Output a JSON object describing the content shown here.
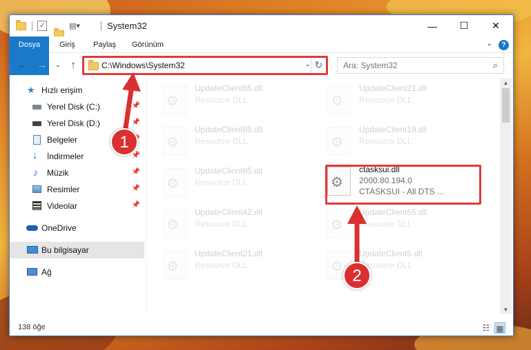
{
  "window": {
    "title": "System32",
    "controls": {
      "minimize": "—",
      "maximize": "☐",
      "close": "✕"
    }
  },
  "ribbon": {
    "tabs": [
      "Dosya",
      "Giriş",
      "Paylaş",
      "Görünüm"
    ],
    "help": "?"
  },
  "address": {
    "path": "C:\\Windows\\System32",
    "search_placeholder": "Ara: System32"
  },
  "nav_pane": {
    "items": [
      {
        "label": "Hızlı erişim",
        "icon": "star-icon",
        "pinned": false
      },
      {
        "label": "Yerel Disk (C:)",
        "icon": "drive-icon",
        "pinned": true
      },
      {
        "label": "Yerel Disk (D:)",
        "icon": "drive-icon",
        "pinned": true
      },
      {
        "label": "Belgeler",
        "icon": "documents-icon",
        "pinned": true
      },
      {
        "label": "İndirmeler",
        "icon": "downloads-icon",
        "pinned": true
      },
      {
        "label": "Müzik",
        "icon": "music-icon",
        "pinned": true
      },
      {
        "label": "Resimler",
        "icon": "pictures-icon",
        "pinned": true
      },
      {
        "label": "Videolar",
        "icon": "videos-icon",
        "pinned": true
      },
      {
        "label": "OneDrive",
        "icon": "cloud-icon",
        "pinned": false
      },
      {
        "label": "Bu bilgisayar",
        "icon": "computer-icon",
        "pinned": false,
        "selected": true
      },
      {
        "label": "Ağ",
        "icon": "network-icon",
        "pinned": false
      }
    ]
  },
  "files": {
    "left_column": [
      {
        "name": "UpdateClient65.dll",
        "type": "Resource DLL"
      },
      {
        "name": "UpdateClient65.dll",
        "type": "Resource DLL"
      },
      {
        "name": "UpdateClient65.dll",
        "type": "Resource DLL"
      },
      {
        "name": "UpdateClient42.dll",
        "type": "Resource DLL"
      },
      {
        "name": "UpdateClient21.dll",
        "type": "Resource DLL"
      }
    ],
    "right_column": [
      {
        "name": "UpdateClient21.dll",
        "type": "Resource DLL"
      },
      {
        "name": "UpdateClient19.dll",
        "type": "Resource DLL"
      },
      {
        "name": "ctasksui.dll",
        "version": "2000.80.194.0",
        "type": "CTASKSUI - All DTS ...",
        "highlighted": true
      },
      {
        "name": "UpdateClient65.dll",
        "type": "Resource DLL"
      },
      {
        "name": "UpdateClient5.dll",
        "type": "Resource DLL"
      }
    ]
  },
  "status": {
    "item_count": "138 öğe"
  },
  "callouts": [
    "1",
    "2"
  ],
  "colors": {
    "accent": "#1979ca",
    "highlight": "#e03a3a"
  }
}
